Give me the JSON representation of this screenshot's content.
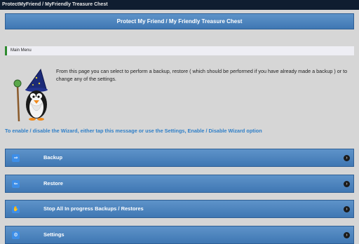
{
  "window": {
    "title": "ProtectMyFriend / MyFriendly Treasure Chest"
  },
  "header": {
    "title": "Protect My Friend / My Friendly Treasure Chest"
  },
  "section": {
    "label": "Main Menu"
  },
  "description": "From this page you can select to perform a backup, restore ( which should be performed if you have already made a backup ) or to change any of the settings.",
  "wizard_notice": "To enable / disable the Wizard, either tap this message or use the Settings, Enable / Disable Wizard option",
  "menu": [
    {
      "label": "Backup",
      "icon": "backup-arrow-icon",
      "glyph": "⇒"
    },
    {
      "label": "Restore",
      "icon": "restore-arrow-icon",
      "glyph": "⇐"
    },
    {
      "label": "Stop All In progress Backups / Restores",
      "icon": "stop-hand-icon",
      "glyph": "✋"
    },
    {
      "label": "Settings",
      "icon": "gear-icon",
      "glyph": "⚙"
    }
  ],
  "colors": {
    "accent_blue": "#4a84c0",
    "link_blue": "#2f7fc8",
    "section_marker": "#2e8b2e"
  }
}
